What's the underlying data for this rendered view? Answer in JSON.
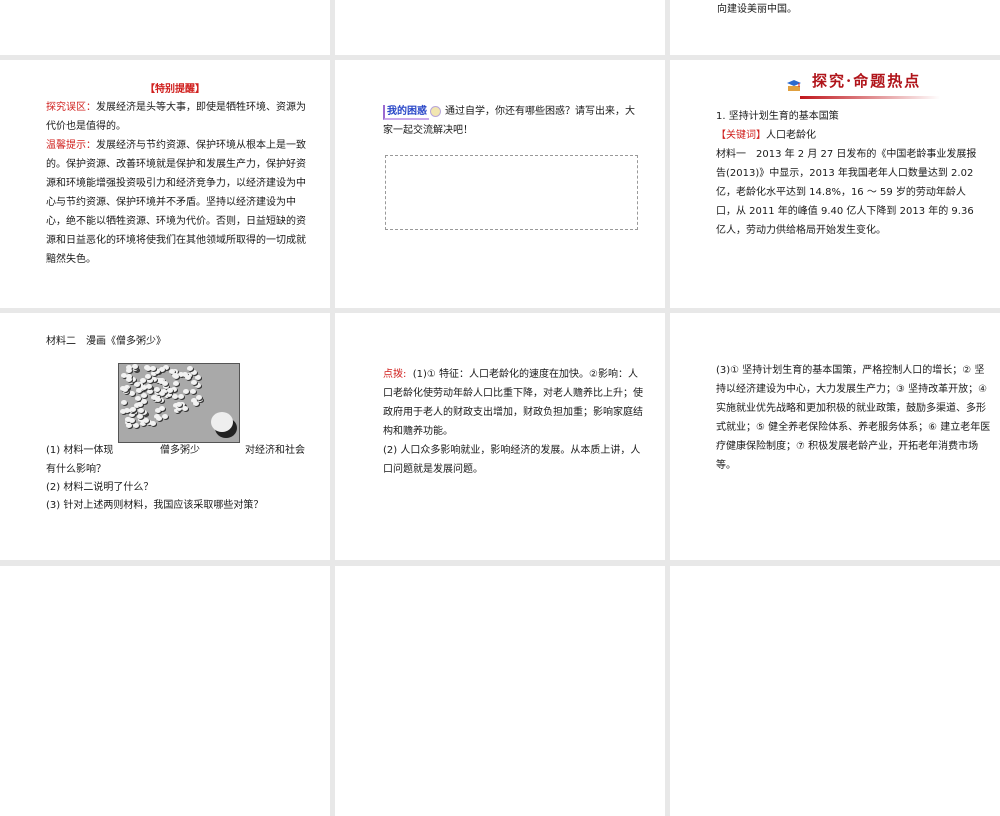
{
  "slides": {
    "top_right_tail": "向建设美丽中国。",
    "reminder": {
      "title": "【特别提醒】",
      "misconception_label": "探究误区：",
      "misconception_text": "发展经济是头等大事，即使是牺牲环境、资源为代价也是值得的。",
      "tip_label": "温馨提示：",
      "tip_text": "发展经济与节约资源、保护环境从根本上是一致的。保护资源、改善环境就是保护和发展生产力，保护好资源和环境能增强投资吸引力和经济竞争力，以经济建设为中心与节约资源、保护环境并不矛盾。坚持以经济建设为中心，绝不能以牺牲资源、环境为代价。否则，日益短缺的资源和日益恶化的环境将使我们在其他领域所取得的一切成就黯然失色。"
    },
    "confusion": {
      "tag": "我的困惑",
      "text": "通过自学，你还有哪些困惑？请写出来，大家一起交流解决吧！"
    },
    "hot_topics": {
      "banner": "探究·命题热点",
      "heading": "1. 坚持计划生育的基本国策",
      "keyword_label": "【关键词】",
      "keyword": "人口老龄化",
      "material1": "材料一　2013 年 2 月 27 日发布的《中国老龄事业发展报告(2013)》中显示，2013 年我国老年人口数量达到 2.02 亿，老龄化水平达到 14.8%，16 ～ 59 岁的劳动年龄人口，从 2011 年的峰值 9.40 亿人下降到 2013 年的 9.36 亿人，劳动力供给格局开始发生变化。"
    },
    "material2": {
      "title": "材料二　漫画《僧多粥少》",
      "q1_a": "(1) 材料一体现",
      "q1_b": "僧多粥少",
      "q1_c": "对经济和社会",
      "q1_d": "有什么影响？",
      "q2": "(2) 材料二说明了什么？",
      "q3": "(3) 针对上述两则材料，我国应该采取哪些对策？"
    },
    "hint": {
      "label": "点拨:",
      "p1": "(1)① 特征：人口老龄化的速度在加快。②影响：人口老龄化使劳动年龄人口比重下降，对老人赡养比上升；使政府用于老人的财政支出增加，财政负担加重；影响家庭结构和赡养功能。",
      "p2": "(2) 人口众多影响就业，影响经济的发展。从本质上讲，人口问题就是发展问题。"
    },
    "answer3": {
      "text": "(3)① 坚持计划生育的基本国策，严格控制人口的增长；② 坚持以经济建设为中心，大力发展生产力；③ 坚持改革开放；④ 实施就业优先战略和更加积极的就业政策，鼓励多渠道、多形式就业；⑤ 健全养老保险体系、养老服务体系；⑥ 建立老年医疗健康保险制度；⑦ 积极发展老龄产业，开拓老年消费市场等。"
    }
  }
}
